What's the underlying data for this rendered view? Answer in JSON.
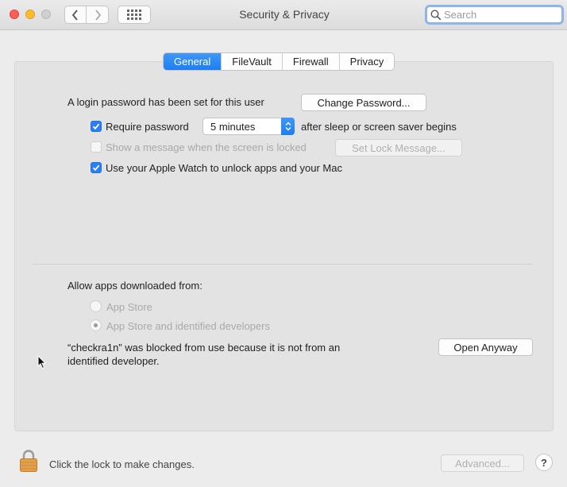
{
  "window": {
    "title": "Security & Privacy",
    "search_placeholder": "Search",
    "icons": {
      "close": "close-traffic-light",
      "minimize": "minimize-traffic-light",
      "maximize": "zoom-traffic-light",
      "back": "chevron-left-icon",
      "forward": "chevron-right-icon",
      "show_all": "grid-icon",
      "search": "search-icon"
    }
  },
  "tabs": [
    {
      "label": "General",
      "active": true
    },
    {
      "label": "FileVault",
      "active": false
    },
    {
      "label": "Firewall",
      "active": false
    },
    {
      "label": "Privacy",
      "active": false
    }
  ],
  "general": {
    "login_password_text": "A login password has been set for this user",
    "change_password_label": "Change Password...",
    "require_password": {
      "checked": true,
      "label": "Require password",
      "popup_value": "5 minutes",
      "suffix": "after sleep or screen saver begins"
    },
    "show_message": {
      "checked": false,
      "enabled": false,
      "label": "Show a message when the screen is locked",
      "button_label": "Set Lock Message..."
    },
    "apple_watch": {
      "checked": true,
      "label": "Use your Apple Watch to unlock apps and your Mac"
    }
  },
  "downloads": {
    "heading": "Allow apps downloaded from:",
    "options": [
      {
        "label": "App Store",
        "selected": false,
        "enabled": false
      },
      {
        "label": "App Store and identified developers",
        "selected": true,
        "enabled": false
      }
    ],
    "blocked_line1": "“checkra1n” was blocked from use because it is not from an",
    "blocked_line2": "identified developer.",
    "open_anyway_label": "Open Anyway"
  },
  "footer": {
    "lock_text": "Click the lock to make changes.",
    "advanced_label": "Advanced...",
    "help_label": "?",
    "lock_icon": "padlock-icon"
  },
  "colors": {
    "accent": "#2a7ff4",
    "lock": "#e3a04a"
  }
}
